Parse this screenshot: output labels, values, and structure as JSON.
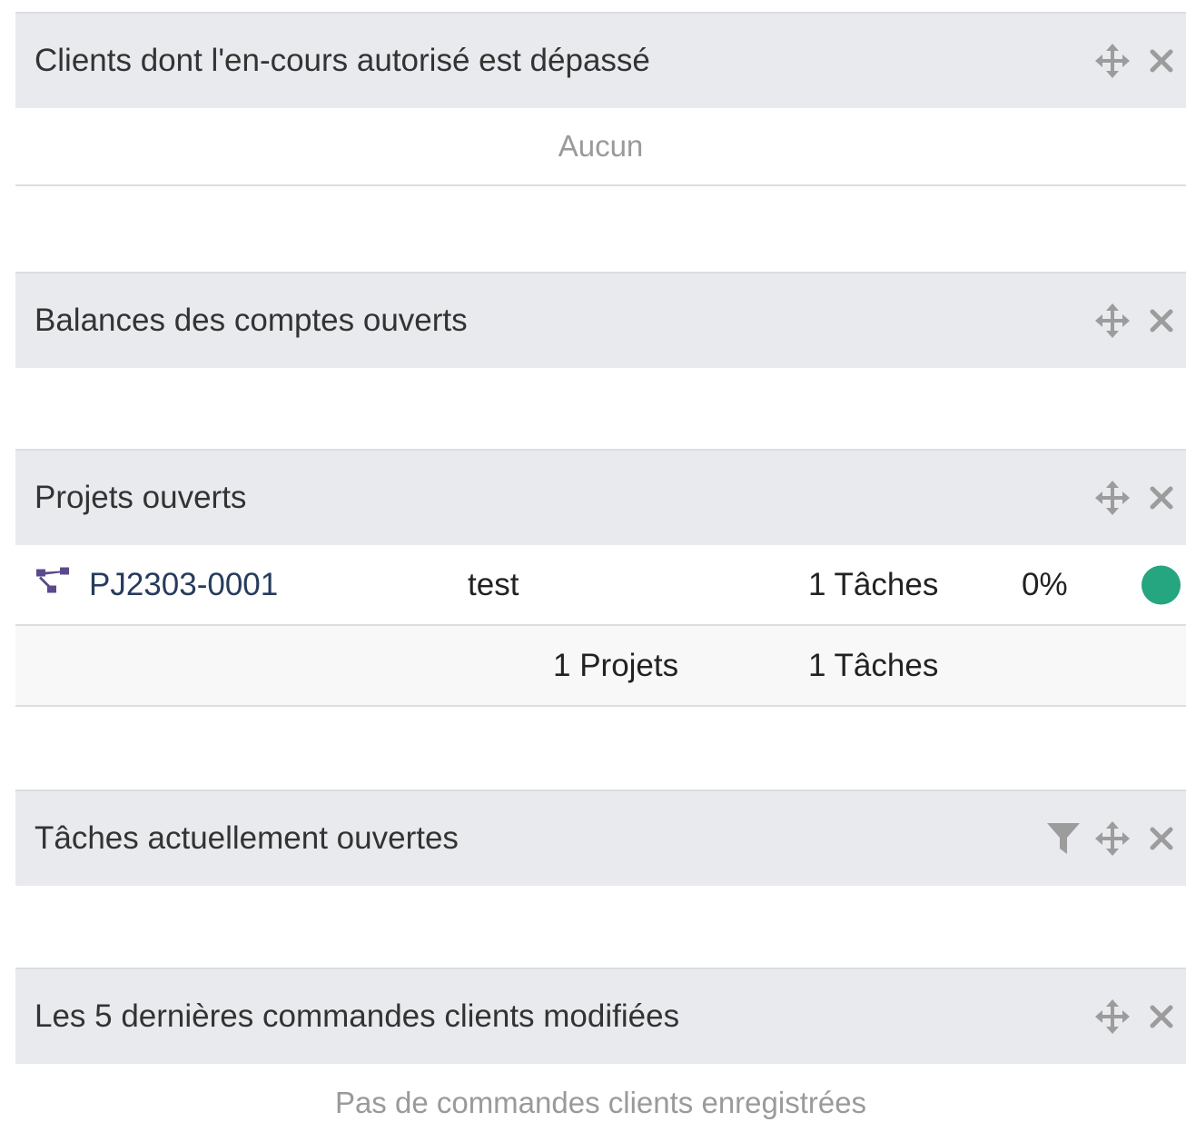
{
  "widgets": [
    {
      "title": "Clients dont l'en-cours autorisé est dépassé",
      "empty_text": "Aucun",
      "actions": [
        "move-icon",
        "close-icon"
      ]
    },
    {
      "title": "Balances des comptes ouverts",
      "actions": [
        "move-icon",
        "close-icon"
      ]
    },
    {
      "title": "Projets ouverts",
      "actions": [
        "move-icon",
        "close-icon"
      ],
      "rows": [
        {
          "icon": "project-icon",
          "ref": "PJ2303-0001",
          "label": "test",
          "tasks": "1 Tâches",
          "progress": "0%",
          "status_color": "#25a580"
        }
      ],
      "total": {
        "projects": "1 Projets",
        "tasks": "1 Tâches"
      }
    },
    {
      "title": "Tâches actuellement ouvertes",
      "actions": [
        "filter-icon",
        "move-icon",
        "close-icon"
      ]
    },
    {
      "title": "Les 5 dernières commandes clients modifiées",
      "actions": [
        "move-icon",
        "close-icon"
      ],
      "empty_text": "Pas de commandes clients enregistrées"
    }
  ],
  "colors": {
    "header_bg": "#e9eaed",
    "status_ok": "#25a580",
    "icon_gray": "#9c9c9c",
    "project_icon": "#5b4a8b"
  }
}
